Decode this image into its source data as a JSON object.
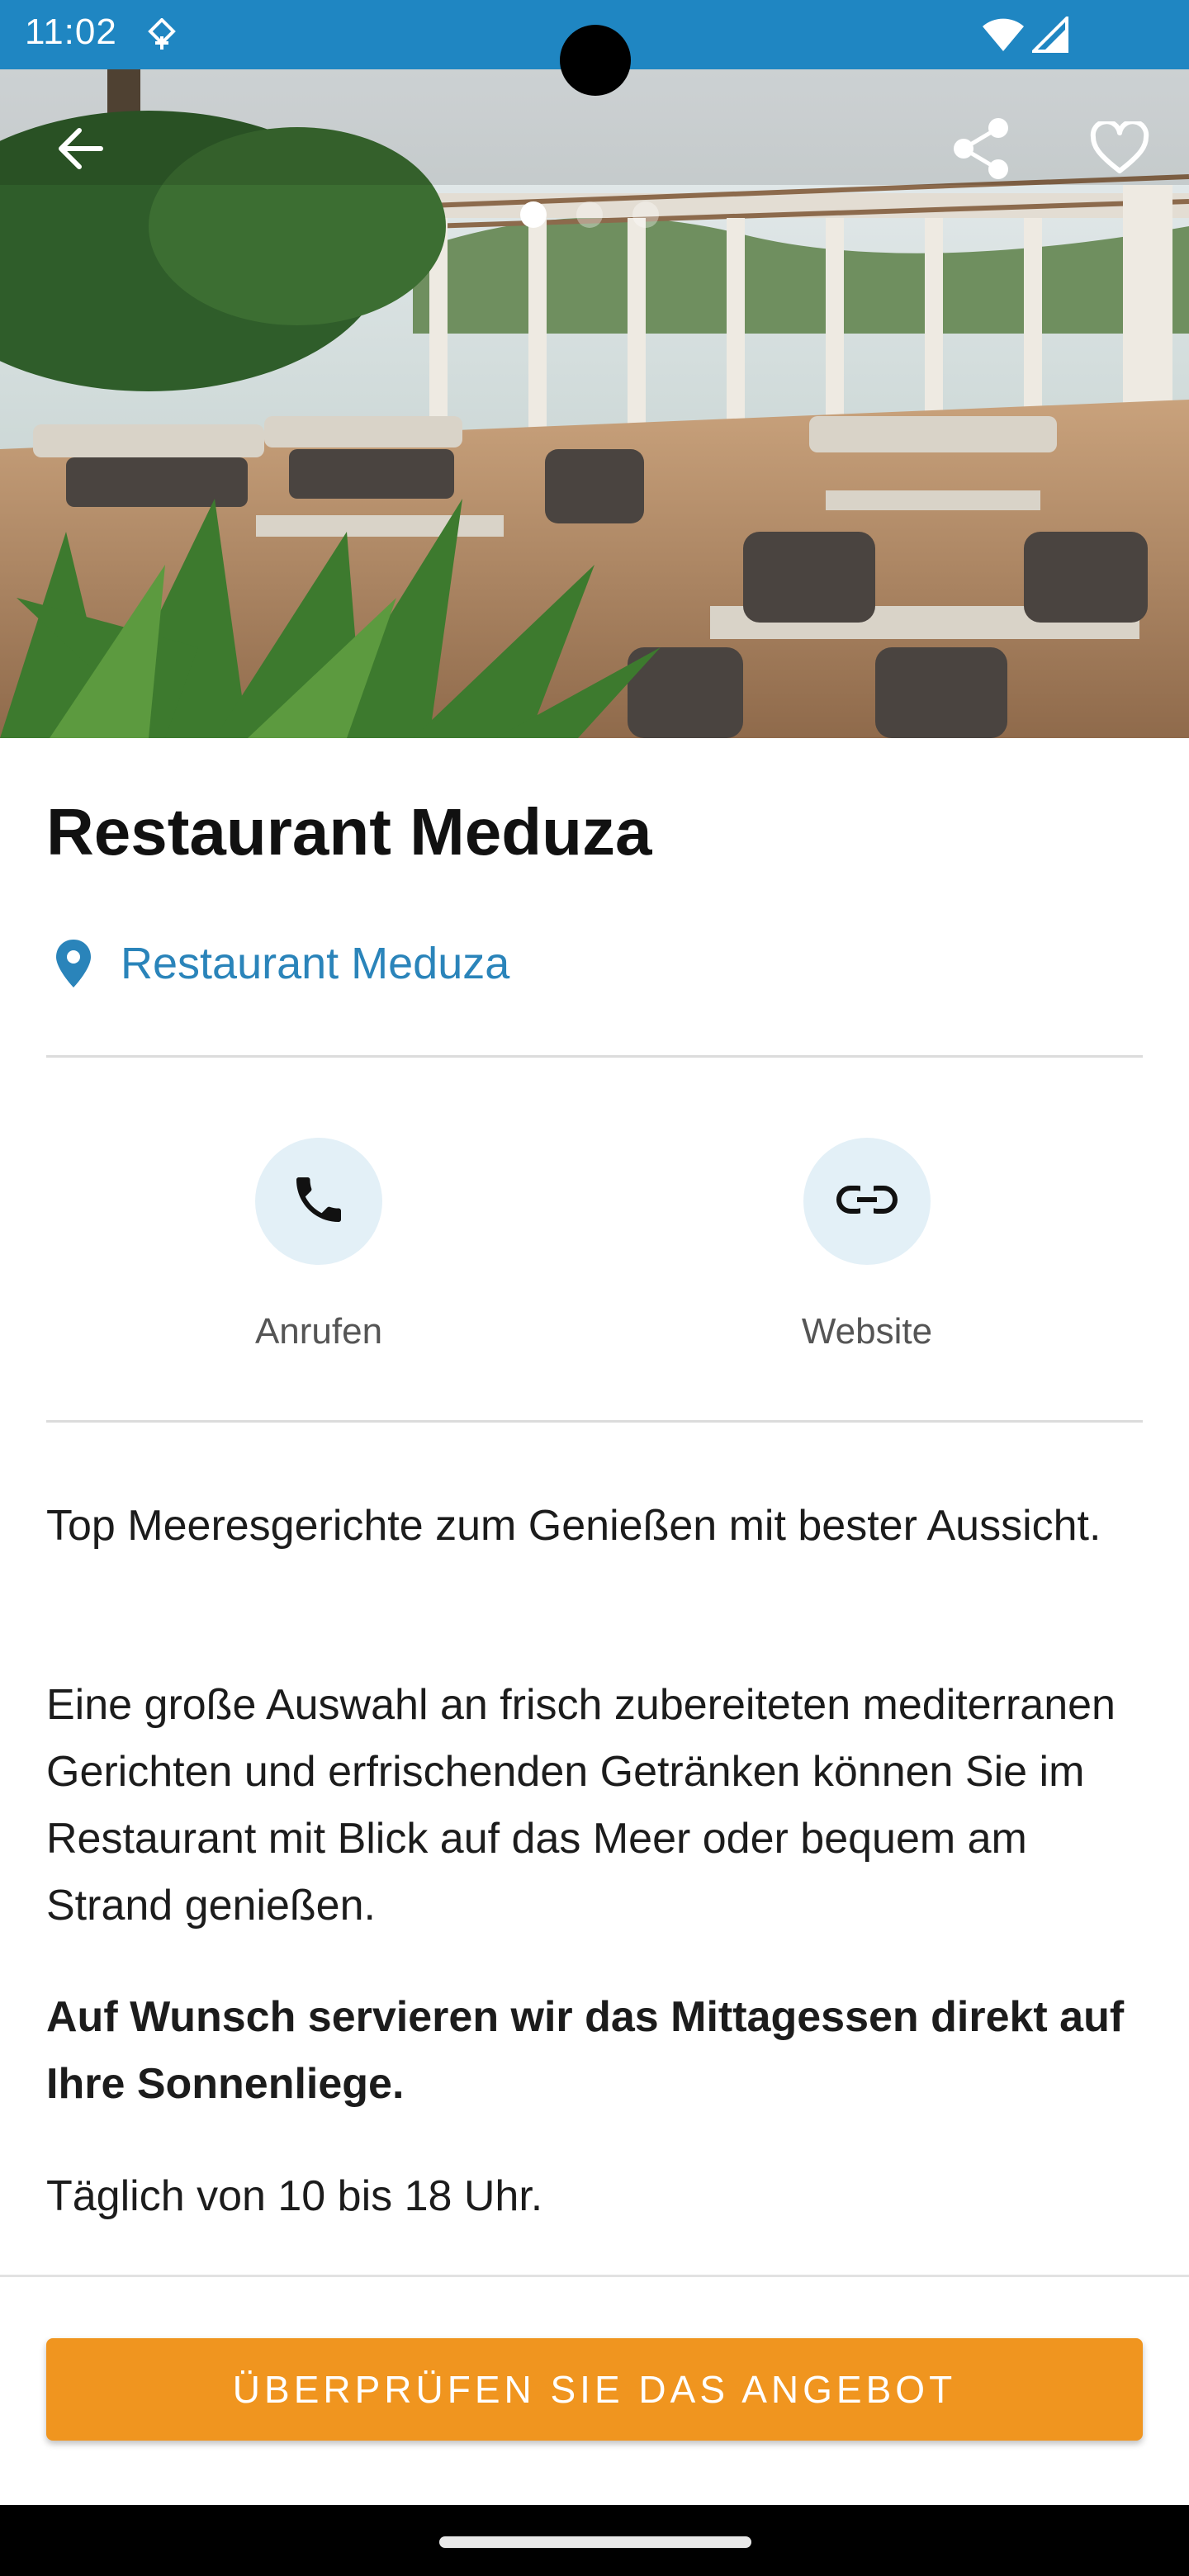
{
  "status_bar": {
    "time": "11:02",
    "icons": [
      "data-saver-icon",
      "wifi-icon",
      "signal-icon"
    ]
  },
  "hero": {
    "image_description_icon": "restaurant-terrace-photo",
    "carousel_total": 3,
    "carousel_active": 1
  },
  "toolbar": {
    "back_icon": "arrow-left-icon",
    "share_icon": "share-icon",
    "favorite_icon": "heart-outline-icon"
  },
  "restaurant": {
    "title": "Restaurant Meduza",
    "location_label": "Restaurant Meduza"
  },
  "actions": {
    "call_label": "Anrufen",
    "website_label": "Website"
  },
  "description": {
    "p1": "Top Meeresgerichte zum Genießen mit bester Aussicht.",
    "p2": "Eine große Auswahl an frisch zubereiteten mediterranen Gerichten und erfrischenden Getränken können Sie im Restaurant mit Blick auf das Meer oder bequem am Strand genießen.",
    "p3": "Auf Wunsch servieren wir das Mittagessen direkt auf Ihre Sonnenliege.",
    "p4": "Täglich von 10 bis 18 Uhr."
  },
  "cta": {
    "label": "ÜBERPRÜFEN SIE DAS ANGEBOT"
  },
  "colors": {
    "status_bar": "#1f86c2",
    "accent_blue": "#2a84ba",
    "cta_orange": "#f0951f",
    "action_circle": "#e3f0f7"
  }
}
